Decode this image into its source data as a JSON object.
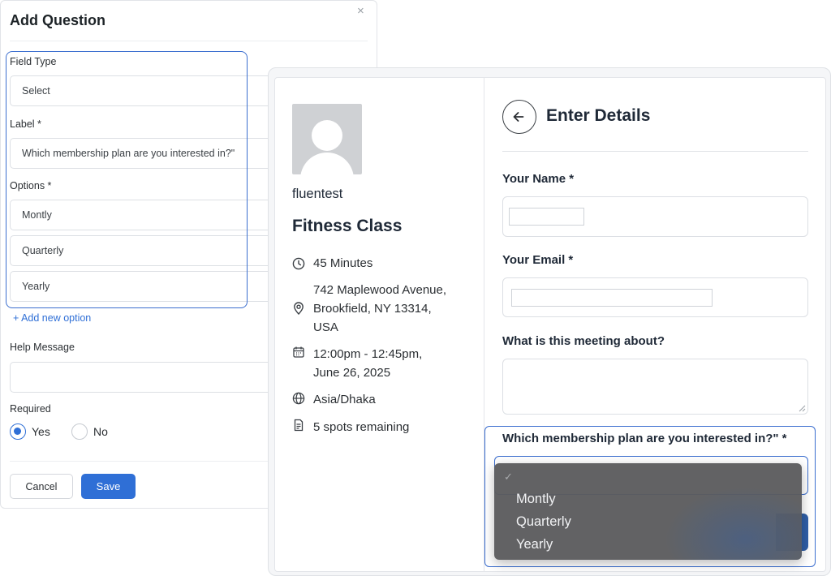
{
  "add_question": {
    "title": "Add Question",
    "close_icon": "×",
    "field_type_label": "Field Type",
    "field_type_value": "Select",
    "label_label": "Label *",
    "label_value": "Which membership plan are you interested in?\"",
    "options_label": "Options *",
    "options": [
      "Montly",
      "Quarterly",
      "Yearly"
    ],
    "add_option": "+ Add new option",
    "help_message_label": "Help Message",
    "help_message_value": "",
    "required_label": "Required",
    "required_yes": "Yes",
    "required_no": "No",
    "required_selected": "Yes",
    "cancel": "Cancel",
    "save": "Save"
  },
  "booking": {
    "host_name": "fluentest",
    "event_title": "Fitness Class",
    "duration": "45 Minutes",
    "location_lines": [
      "742 Maplewood Avenue,",
      "Brookfield, NY 13314,",
      "USA"
    ],
    "datetime_lines": [
      "12:00pm - 12:45pm,",
      "June 26, 2025"
    ],
    "timezone": "Asia/Dhaka",
    "spots": "5 spots remaining",
    "icons": [
      "clock-icon",
      "location-pin-icon",
      "calendar-icon",
      "globe-icon",
      "document-icon"
    ]
  },
  "form": {
    "back_icon": "arrow-left-icon",
    "title": "Enter Details",
    "name_label": "Your Name *",
    "email_label": "Your Email *",
    "meeting_label": "What is this meeting about?",
    "membership_label": "Which membership plan are you interested in?\" *",
    "dropdown_check": "✓",
    "dropdown_options": [
      "Montly",
      "Quarterly",
      "Yearly"
    ]
  },
  "colors": {
    "accent": "#2f6fd6",
    "highlight": "#3b6ecf",
    "dropdown_bg": "#5c5c5e"
  }
}
